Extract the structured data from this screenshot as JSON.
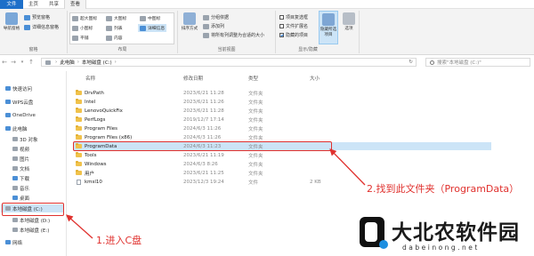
{
  "ribbon_tabs": [
    "文件",
    "主页",
    "共享",
    "查看"
  ],
  "ribbon": {
    "pane_group": {
      "nav_pane": "导航窗格",
      "preview_pane": "预览窗格",
      "details_pane": "详细信息窗格",
      "label": "窗格"
    },
    "layout_group": {
      "items": [
        "超大图标",
        "大图标",
        "中图标",
        "小图标",
        "列表",
        "详细信息",
        "平铺",
        "内容"
      ],
      "label": "布局"
    },
    "view_group": {
      "sort": "排序方式",
      "group_by": "分组依据",
      "add_columns": "添加列",
      "fit_columns": "将所有列调整为合适的大小",
      "label": "当前视图"
    },
    "show_hide_group": {
      "item_checkbox": "项目复选框",
      "file_ext": "文件扩展名",
      "hidden_items": "隐藏的项目",
      "hide_selected": "隐藏所选项目",
      "options": "选项",
      "label": "显示/隐藏"
    }
  },
  "address": {
    "path": [
      "此电脑",
      "本地磁盘 (C:)"
    ],
    "search_placeholder": "搜索\"本地磁盘 (C:)\""
  },
  "columns": {
    "name": "名称",
    "date": "修改日期",
    "type": "类型",
    "size": "大小"
  },
  "nav_items": [
    {
      "label": "快速访问",
      "icon": "star-icon"
    },
    {
      "label": "WPS云盘",
      "icon": "cloud-icon"
    },
    {
      "label": "OneDrive",
      "icon": "onedrive-icon"
    },
    {
      "label": "此电脑",
      "icon": "computer-icon"
    },
    {
      "label": "3D 对象",
      "icon": "cube-icon"
    },
    {
      "label": "视频",
      "icon": "video-icon"
    },
    {
      "label": "图片",
      "icon": "picture-icon"
    },
    {
      "label": "文档",
      "icon": "document-icon"
    },
    {
      "label": "下载",
      "icon": "download-icon"
    },
    {
      "label": "音乐",
      "icon": "music-icon"
    },
    {
      "label": "桌面",
      "icon": "desktop-icon"
    },
    {
      "label": "本地磁盘 (C:)",
      "icon": "drive-icon"
    },
    {
      "label": "本地磁盘 (D:)",
      "icon": "drive-icon"
    },
    {
      "label": "本地磁盘 (E:)",
      "icon": "drive-icon"
    },
    {
      "label": "网络",
      "icon": "network-icon"
    }
  ],
  "files": [
    {
      "name": "DrvPath",
      "date": "2023/6/21 11:28",
      "type": "文件夹",
      "size": "",
      "kind": "folder"
    },
    {
      "name": "Intel",
      "date": "2023/6/21 11:26",
      "type": "文件夹",
      "size": "",
      "kind": "folder"
    },
    {
      "name": "LenovoQuickFix",
      "date": "2023/6/21 11:28",
      "type": "文件夹",
      "size": "",
      "kind": "folder"
    },
    {
      "name": "PerfLogs",
      "date": "2019/12/7 17:14",
      "type": "文件夹",
      "size": "",
      "kind": "folder"
    },
    {
      "name": "Program Files",
      "date": "2024/6/3 11:26",
      "type": "文件夹",
      "size": "",
      "kind": "folder"
    },
    {
      "name": "Program Files (x86)",
      "date": "2024/6/3 11:26",
      "type": "文件夹",
      "size": "",
      "kind": "folder"
    },
    {
      "name": "ProgramData",
      "date": "2024/6/3 11:23",
      "type": "文件夹",
      "size": "",
      "kind": "folder"
    },
    {
      "name": "Tools",
      "date": "2023/6/21 11:19",
      "type": "文件夹",
      "size": "",
      "kind": "folder"
    },
    {
      "name": "Windows",
      "date": "2024/6/3 8:26",
      "type": "文件夹",
      "size": "",
      "kind": "folder"
    },
    {
      "name": "用户",
      "date": "2023/6/21 11:25",
      "type": "文件夹",
      "size": "",
      "kind": "folder"
    },
    {
      "name": "kmsl10",
      "date": "2023/12/3 19:24",
      "type": "文件",
      "size": "2 KB",
      "kind": "file"
    }
  ],
  "annotations": {
    "step1": "1.进入C盘",
    "step2": "2.找到此文件夹（ProgramData）"
  },
  "watermark": {
    "name": "大北农软件园",
    "url": "dabeinong.net"
  },
  "colors": {
    "accent": "#1e6fc9",
    "annotation": "#e0312e",
    "selection": "#cce4f7"
  }
}
